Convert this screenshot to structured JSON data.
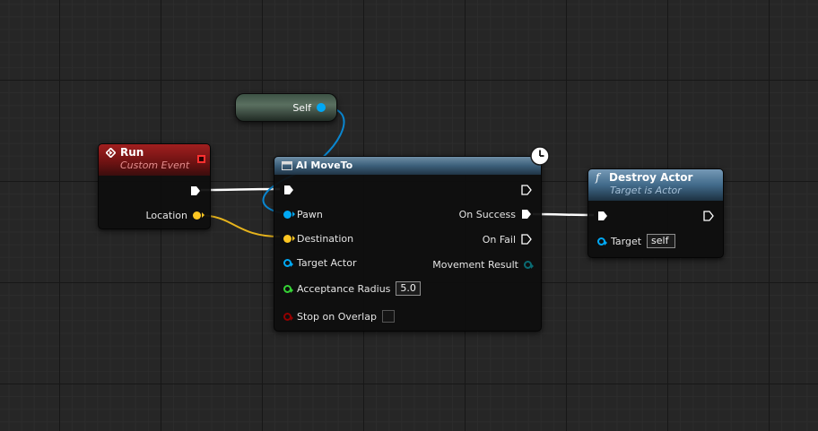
{
  "self_node": {
    "pin_label": "Self"
  },
  "run_node": {
    "title": "Run",
    "subtitle": "Custom Event",
    "location_label": "Location"
  },
  "moveto_node": {
    "title": "AI MoveTo",
    "inputs": {
      "pawn": "Pawn",
      "destination": "Destination",
      "target_actor": "Target Actor",
      "acceptance_radius": "Acceptance Radius",
      "acceptance_radius_value": "5.0",
      "stop_on_overlap": "Stop on Overlap"
    },
    "outputs": {
      "on_success": "On Success",
      "on_fail": "On Fail",
      "movement_result": "Movement Result"
    }
  },
  "destroy_node": {
    "title": "Destroy Actor",
    "subtitle": "Target is Actor",
    "target_label": "Target",
    "target_value": "self"
  },
  "colors": {
    "object_pin": "#00a8f4",
    "vector_pin": "#fdc622",
    "float_pin": "#35d335",
    "bool_pin": "#930000",
    "struct_pin": "#0a6b73",
    "exec_pin": "#ffffff",
    "event_header": "#8e1818",
    "function_header": "#416a8a"
  },
  "icons": [
    "event-diamond-icon",
    "clock-icon",
    "function-icon",
    "node-icon"
  ]
}
